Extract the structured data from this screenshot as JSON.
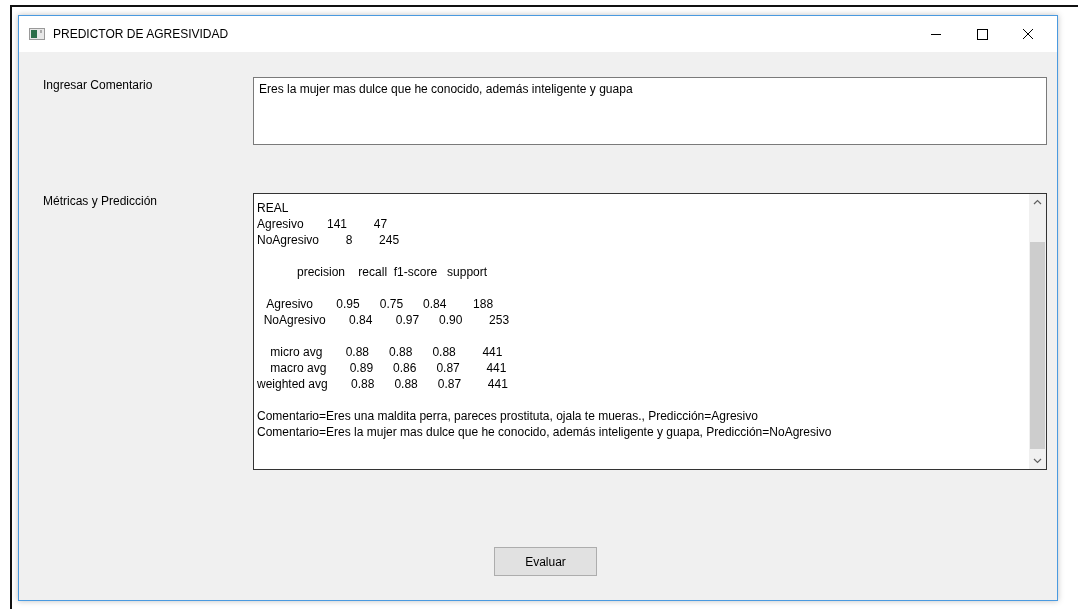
{
  "window": {
    "title": "PREDICTOR DE AGRESIVIDAD"
  },
  "comment": {
    "label": "Ingresar Comentario",
    "value": "Eres la mujer mas dulce que he conocido, además inteligente y guapa"
  },
  "output": {
    "label": "Métricas y Predicción",
    "blocks": [
      [
        "REAL",
        "Agresivo       141        47",
        "NoAgresivo        8        245"
      ],
      [
        "            precision    recall  f1-score   support"
      ],
      [
        "   Agresivo       0.95      0.75      0.84        188",
        "  NoAgresivo       0.84       0.97      0.90        253"
      ],
      [
        "    micro avg       0.88      0.88      0.88        441",
        "    macro avg       0.89      0.86      0.87        441",
        "weighted avg       0.88      0.88      0.87        441"
      ],
      [
        "Comentario=Eres una maldita perra, pareces prostituta, ojala te mueras., Predicción=Agresivo",
        "Comentario=Eres la mujer mas dulce que he conocido, además inteligente y guapa, Predicción=NoAgresivo"
      ]
    ]
  },
  "buttons": [
    "Evaluar"
  ]
}
